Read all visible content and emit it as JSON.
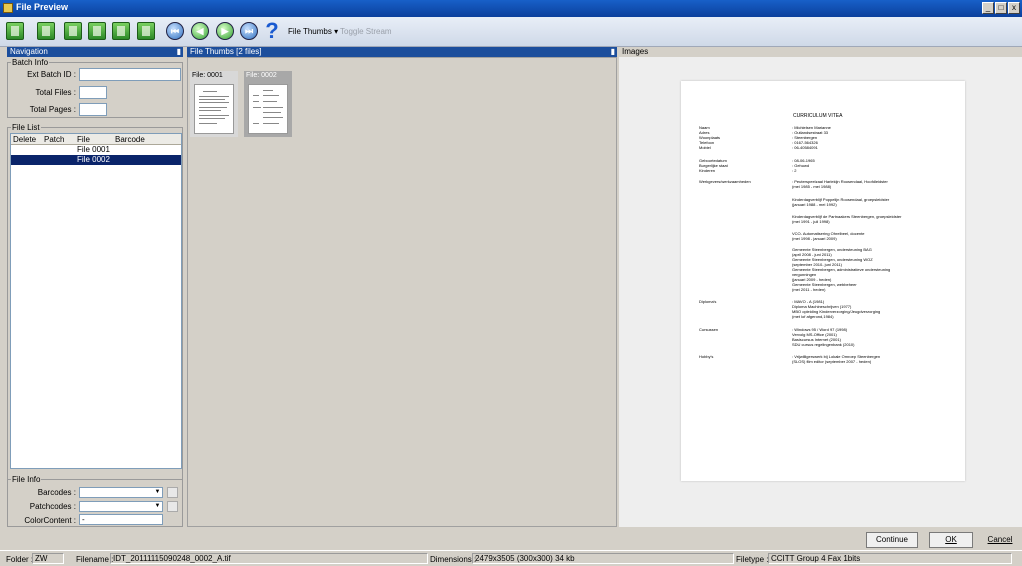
{
  "window": {
    "title": "File Preview",
    "btn_min": "_",
    "btn_max": "□",
    "btn_close": "x"
  },
  "toolbar": {
    "file_thumbs": "File Thumbs ▾",
    "toggle_stream": "Toggle Stream",
    "help": "?"
  },
  "navigation": {
    "header": "Navigation",
    "pin": "▮",
    "batch_info": {
      "legend": "Batch Info",
      "ext_batch_id_label": "Ext Batch ID :",
      "ext_batch_id": "",
      "total_files_label": "Total Files :",
      "total_files": "",
      "total_pages_label": "Total Pages :",
      "total_pages": ""
    },
    "file_list": {
      "legend": "File List",
      "columns": [
        "Delete",
        "Patch",
        "File",
        "Barcode"
      ],
      "rows": [
        "File 0001",
        "File 0002"
      ],
      "selected_index": 1
    },
    "file_info": {
      "legend": "File Info",
      "barcodes_label": "Barcodes :",
      "patchcodes_label": "Patchcodes :",
      "color_content_label": "ColorContent :",
      "color_content_value": "-",
      "combo_arrow": "▼"
    }
  },
  "thumbs_panel": {
    "header": "File Thumbs [2 files]",
    "pin": "▮",
    "items": [
      {
        "caption": "File: 0001",
        "selected": false
      },
      {
        "caption": "File: 0002",
        "selected": true
      }
    ]
  },
  "images_panel": {
    "header": "Images",
    "doc_title": "CURRICULUM VITEA",
    "cv_rows": [
      {
        "k": "Naam\nAdres\nWoonplaats\nTelefoon\nMobiel",
        "v": ": Michielsen Marianne\n: Outlandsestraat 33\n: Steenbergen\n: 0167-564326\n: 06-40584091"
      },
      {
        "k": "Geboortedatum\nBurgerlijke staat\nKinderen",
        "v": ": 08-06-1965\n: Gehuwd\n: 2"
      },
      {
        "k": "Werkgevers/werkzaamheden",
        "v": ": Peuterspeelzaal Harlekijn Roosendaal, Hoofdleidster\n(mei 1985 - mei 1988)"
      },
      {
        "k": "",
        "v": "Kinderdagverblijf Poppelijn Roosendaal, groepsleidster\n(januari 1988 - mei 1992)"
      },
      {
        "k": "",
        "v": "Kinderdagverblijf de Partnaakers Steenbergen, groepsleidster\n(mei 1991 - juli 1998)"
      },
      {
        "k": "",
        "v": "VCO- Automatisering Ohrelbeel, docente\n(mei 1998 - januari 2009)"
      },
      {
        "k": "",
        "v": "Gemeente Steenbergen, ondersteuning BAG\n(april 2008 - juni 2011)\nGemeente Steenbergen, ondersteuning WOZ\n(september 2010- juni 2011)\nGemeente Steenbergen, administratieve ondersteuning\nvergunningen\n(januari 2009 - heden)\nGemeente Steenbergen, webbeheer\n(mei 2011 - heden)"
      },
      {
        "k": "Diploma's",
        "v": ": MAVO - A (1981)\nDiploma Machineschrijven (1977)\nMBO opleiding Kinderverzorging/Jeugdverzorging\n(met lof afgerond,1984)"
      },
      {
        "k": "Cursussen",
        "v": ": Windows 95 / Word 97 (1998)\nVervolg MS-Office (2001)\nBasiscursus Internet (2001)\nSDU cursus regelingenbank (2010)"
      },
      {
        "k": "Hobby's",
        "v": ": Vrijwilligerswerk bij Lokale Omroep Steenbergen\n(SLOS) film editor (september 2007 - heden)"
      }
    ]
  },
  "buttons": {
    "continue": "Continue",
    "ok": "OK",
    "cancel": "Cancel"
  },
  "statusbar": {
    "folder_label": "Folder :",
    "folder_value": "ZW",
    "filename_label": "Filename :",
    "filename_value": "IDT_20111115090248_0002_A.tif",
    "dimensions_label": "Dimensions :",
    "dimensions_value": "2479x3505 (300x300) 34 kb",
    "filetype_label": "Filetype :",
    "filetype_value": "CCITT Group 4 Fax 1bits"
  }
}
